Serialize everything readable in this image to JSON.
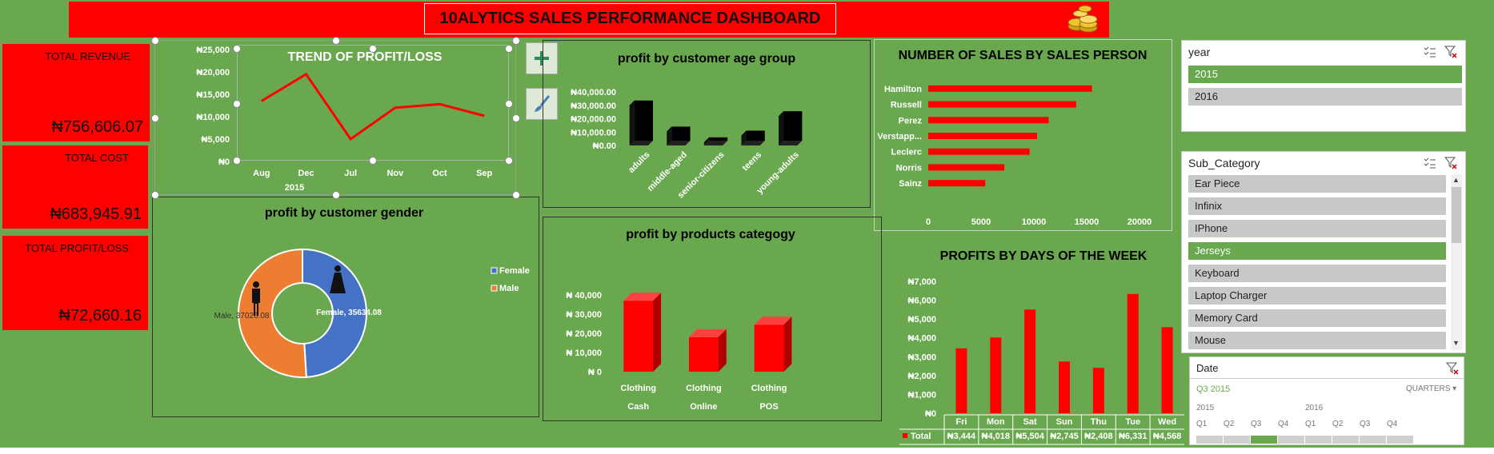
{
  "dashboard": {
    "title": "10ALYTICS SALES PERFORMANCE DASHBOARD",
    "logo_icon": "gold-coins-icon"
  },
  "kpis": {
    "revenue": {
      "label": "TOTAL REVENUE",
      "value": "₦756,606.07"
    },
    "cost": {
      "label": "TOTAL COST",
      "value": "₦683,945.91"
    },
    "profit": {
      "label": "TOTAL PROFIT/LOSS",
      "value": "₦72,660.16"
    }
  },
  "colors": {
    "background": "#6aa84f",
    "accent": "#ff0000",
    "male": "#ed7d31",
    "female": "#4472c4"
  },
  "chart_tools": {
    "add_icon": "plus-icon",
    "style_icon": "paintbrush-icon"
  },
  "chart_data": [
    {
      "id": "trend",
      "type": "line",
      "title": "TREND OF PROFIT/LOSS",
      "categories": [
        "Aug",
        "Dec",
        "Jul",
        "Nov",
        "Oct",
        "Sep"
      ],
      "values": [
        13500,
        19500,
        5000,
        12000,
        12800,
        10200
      ],
      "y_ticks": [
        "₦0",
        "₦5,000",
        "₦10,000",
        "₦15,000",
        "₦20,000",
        "₦25,000"
      ],
      "ylim": [
        0,
        25000
      ],
      "xlabel": "2015",
      "color": "#ff0000"
    },
    {
      "id": "age",
      "type": "bar",
      "title": "profit by customer age group",
      "categories": [
        "adults",
        "middle-aged",
        "senior-citizens",
        "teens",
        "young-adults"
      ],
      "values": [
        30000,
        10500,
        2500,
        7500,
        22000
      ],
      "y_ticks": [
        "₦0.00",
        "₦10,000.00",
        "₦20,000.00",
        "₦30,000.00",
        "₦40,000.00"
      ],
      "ylim": [
        0,
        40000
      ],
      "color": "#000000"
    },
    {
      "id": "salesperson",
      "type": "bar",
      "title": "NUMBER OF SALES BY SALES PERSON",
      "categories": [
        "Hamilton",
        "Russell",
        "Perez",
        "Verstapp...",
        "Leclerc",
        "Norris",
        "Sainz"
      ],
      "values": [
        15500,
        14000,
        11400,
        10300,
        9600,
        7200,
        5400
      ],
      "x_ticks": [
        "0",
        "5000",
        "10000",
        "15000",
        "20000"
      ],
      "xlim": [
        0,
        20000
      ],
      "orientation": "horizontal",
      "color": "#ff0000"
    },
    {
      "id": "gender",
      "type": "pie",
      "title": "profit by customer gender",
      "slices": [
        {
          "name": "Female",
          "value": 35634.08,
          "label": "Female, 35634.08",
          "color": "#4472c4"
        },
        {
          "name": "Male",
          "value": 37026.08,
          "label": "Male, 37026.08",
          "color": "#ed7d31"
        }
      ],
      "legend": [
        "Female",
        "Male"
      ],
      "legend_position": "right"
    },
    {
      "id": "products",
      "type": "bar",
      "title": "profit by products categogy",
      "categories": [
        "Clothing",
        "Clothing",
        "Clothing"
      ],
      "subcategories": [
        "Cash",
        "Online",
        "POS"
      ],
      "values": [
        37000,
        18000,
        24500
      ],
      "y_ticks": [
        "₦ 0",
        "₦ 10,000",
        "₦ 20,000",
        "₦ 30,000",
        "₦ 40,000"
      ],
      "ylim": [
        0,
        40000
      ],
      "color": "#ff0000"
    },
    {
      "id": "days",
      "type": "bar",
      "title": "PROFITS BY DAYS OF THE WEEK",
      "categories": [
        "Fri",
        "Mon",
        "Sat",
        "Sun",
        "Thu",
        "Tue",
        "Wed"
      ],
      "values": [
        3444,
        4018,
        5504,
        2745,
        2408,
        6331,
        4568
      ],
      "table_labels": [
        "₦3,444",
        "₦4,018",
        "₦5,504",
        "₦2,745",
        "₦2,408",
        "₦6,331",
        "₦4,568"
      ],
      "series_label": "Total",
      "y_ticks": [
        "₦0",
        "₦1,000",
        "₦2,000",
        "₦3,000",
        "₦4,000",
        "₦5,000",
        "₦6,000",
        "₦7,000"
      ],
      "ylim": [
        0,
        7000
      ],
      "color": "#ff0000"
    }
  ],
  "slicers": {
    "year": {
      "title": "year",
      "items": [
        {
          "label": "2015",
          "selected": true
        },
        {
          "label": "2016",
          "selected": false
        }
      ]
    },
    "sub_category": {
      "title": "Sub_Category",
      "items": [
        {
          "label": "Ear Piece",
          "selected": false
        },
        {
          "label": "Infinix",
          "selected": false
        },
        {
          "label": "IPhone",
          "selected": false
        },
        {
          "label": "Jerseys",
          "selected": true
        },
        {
          "label": "Keyboard",
          "selected": false
        },
        {
          "label": "Laptop Charger",
          "selected": false
        },
        {
          "label": "Memory Card",
          "selected": false
        },
        {
          "label": "Mouse",
          "selected": false
        }
      ]
    },
    "date": {
      "title": "Date",
      "selection": "Q3 2015",
      "granularity": "QUARTERS",
      "years": [
        "2015",
        "2016"
      ],
      "quarters": [
        "Q1",
        "Q2",
        "Q3",
        "Q4",
        "Q1",
        "Q2",
        "Q3",
        "Q4"
      ]
    }
  }
}
